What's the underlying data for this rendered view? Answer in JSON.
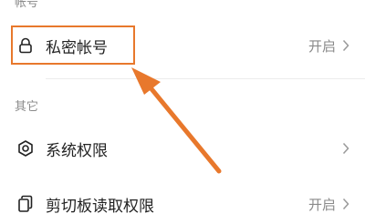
{
  "sections": {
    "account": {
      "header": "帐号"
    },
    "other": {
      "header": "其它"
    }
  },
  "rows": {
    "private_account": {
      "label": "私密帐号",
      "value": "开启",
      "icon": "lock-icon"
    },
    "system_permissions": {
      "label": "系统权限",
      "value": "",
      "icon": "settings-gear-icon"
    },
    "clipboard_permissions": {
      "label": "剪切板读取权限",
      "value": "开启",
      "icon": "clipboard-copy-icon"
    }
  },
  "colors": {
    "annotation": "#e8782c",
    "label": "#222222",
    "secondary": "#8a8a8a"
  }
}
